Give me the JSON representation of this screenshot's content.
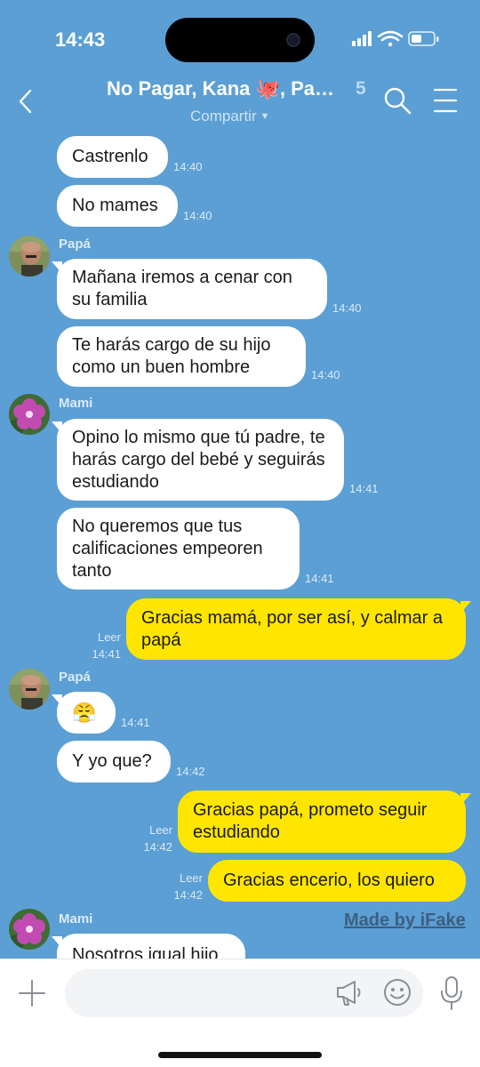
{
  "status_bar": {
    "time": "14:43"
  },
  "header": {
    "title": "No Pagar, Kana 🐙, Pa…",
    "member_count": "5",
    "subtitle": "Compartir"
  },
  "messages": [
    {
      "sender": "",
      "text": "Castrenlo",
      "time": "14:40"
    },
    {
      "sender": "",
      "text": "No mames",
      "time": "14:40"
    },
    {
      "sender": "Papá",
      "text": "Mañana iremos a cenar con su familia",
      "time": "14:40"
    },
    {
      "sender": "",
      "text": "Te harás cargo de su hijo como un buen hombre",
      "time": "14:40"
    },
    {
      "sender": "Mami",
      "text": "Opino lo mismo que tú padre, te harás cargo del bebé y seguirás estudiando",
      "time": "14:41"
    },
    {
      "sender": "",
      "text": "No queremos que tus calificaciones empeoren tanto",
      "time": "14:41"
    },
    {
      "sender": "me",
      "text": "Gracias mamá, por ser así, y calmar a papá",
      "read": "Leer",
      "time": "14:41"
    },
    {
      "sender": "Papá",
      "text": "😤",
      "time": "14:41"
    },
    {
      "sender": "",
      "text": "Y yo que?",
      "time": "14:42"
    },
    {
      "sender": "me",
      "text": "Gracias papá, prometo seguir estudiando",
      "read": "Leer",
      "time": "14:42"
    },
    {
      "sender": "me",
      "text": "Gracias encerio, los quiero",
      "read": "Leer",
      "time": "14:42"
    },
    {
      "sender": "Mami",
      "text": "Nosotros igual hijo",
      "time": ""
    }
  ],
  "watermark": "Made by iFake",
  "icons": {
    "back": "chevron-left-icon",
    "search": "search-icon",
    "menu": "hamburger-menu-icon",
    "plus": "plus-icon",
    "megaphone": "megaphone-icon",
    "emoji": "emoji-icon",
    "mic": "microphone-icon"
  },
  "colors": {
    "chat_background": "#5b9fd4",
    "outgoing_bubble": "#ffe600",
    "incoming_bubble": "#ffffff"
  }
}
